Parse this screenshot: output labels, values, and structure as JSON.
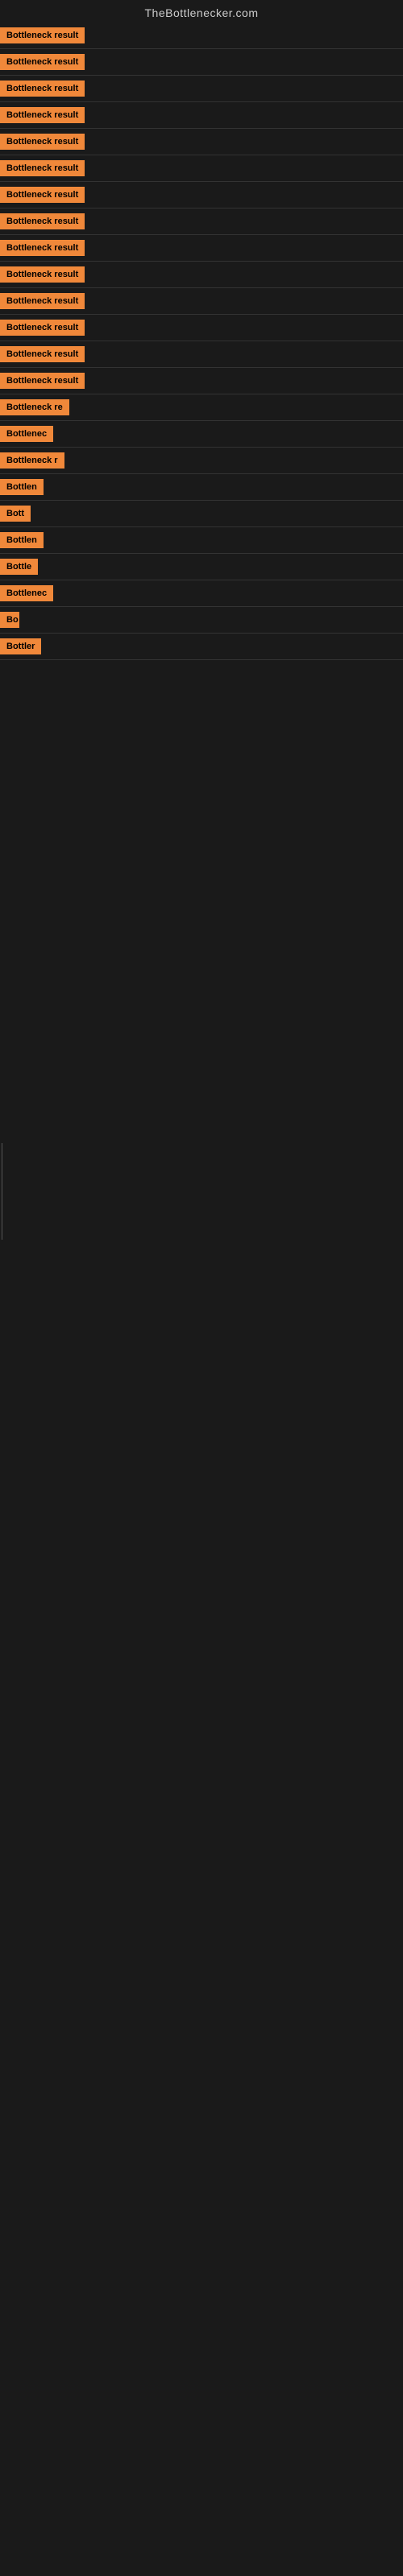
{
  "header": {
    "site_title": "TheBottlenecker.com"
  },
  "rows": [
    {
      "id": 1,
      "label": "Bottleneck result",
      "badge_width": 120
    },
    {
      "id": 2,
      "label": "Bottleneck result",
      "badge_width": 120
    },
    {
      "id": 3,
      "label": "Bottleneck result",
      "badge_width": 120
    },
    {
      "id": 4,
      "label": "Bottleneck result",
      "badge_width": 120
    },
    {
      "id": 5,
      "label": "Bottleneck result",
      "badge_width": 120
    },
    {
      "id": 6,
      "label": "Bottleneck result",
      "badge_width": 120
    },
    {
      "id": 7,
      "label": "Bottleneck result",
      "badge_width": 120
    },
    {
      "id": 8,
      "label": "Bottleneck result",
      "badge_width": 120
    },
    {
      "id": 9,
      "label": "Bottleneck result",
      "badge_width": 120
    },
    {
      "id": 10,
      "label": "Bottleneck result",
      "badge_width": 120
    },
    {
      "id": 11,
      "label": "Bottleneck result",
      "badge_width": 120
    },
    {
      "id": 12,
      "label": "Bottleneck result",
      "badge_width": 120
    },
    {
      "id": 13,
      "label": "Bottleneck result",
      "badge_width": 120
    },
    {
      "id": 14,
      "label": "Bottleneck result",
      "badge_width": 120
    },
    {
      "id": 15,
      "label": "Bottleneck re",
      "badge_width": 95
    },
    {
      "id": 16,
      "label": "Bottlenec",
      "badge_width": 72
    },
    {
      "id": 17,
      "label": "Bottleneck r",
      "badge_width": 88
    },
    {
      "id": 18,
      "label": "Bottlen",
      "badge_width": 60
    },
    {
      "id": 19,
      "label": "Bott",
      "badge_width": 40
    },
    {
      "id": 20,
      "label": "Bottlen",
      "badge_width": 60
    },
    {
      "id": 21,
      "label": "Bottle",
      "badge_width": 52
    },
    {
      "id": 22,
      "label": "Bottlenec",
      "badge_width": 72
    },
    {
      "id": 23,
      "label": "Bo",
      "badge_width": 24
    },
    {
      "id": 24,
      "label": "Bottler",
      "badge_width": 55
    }
  ],
  "colors": {
    "badge_bg": "#f0883a",
    "badge_text": "#000000",
    "background": "#1a1a1a",
    "title_text": "#cccccc",
    "divider": "#333333"
  }
}
